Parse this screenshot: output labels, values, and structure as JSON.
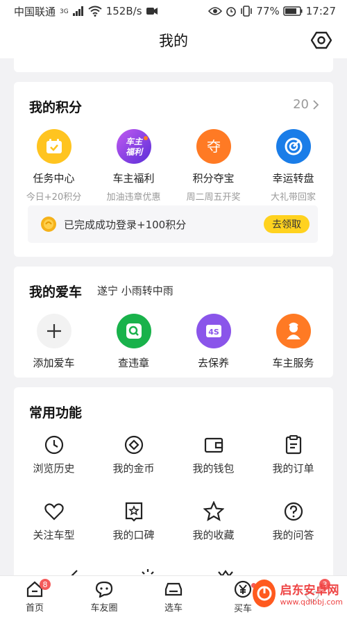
{
  "status_bar": {
    "carrier": "中国联通",
    "network": "3G",
    "speed": "152B/s",
    "battery": "77%",
    "time": "17:27"
  },
  "header": {
    "title": "我的"
  },
  "points": {
    "title": "我的积分",
    "count": "20",
    "items": [
      {
        "label": "任务中心",
        "sub": "今日+20积分",
        "color": "#ffc420"
      },
      {
        "label": "车主福利",
        "sub": "加油违章优惠",
        "color": "#7b3fe0",
        "badge": "车主\n福利"
      },
      {
        "label": "积分夺宝",
        "sub": "周二周五开奖",
        "color": "#ff7a24",
        "glyph": "夺"
      },
      {
        "label": "幸运转盘",
        "sub": "大礼带回家",
        "color": "#1a7de8"
      }
    ],
    "bonus_text": "已完成成功登录+100积分",
    "bonus_button": "去领取"
  },
  "car": {
    "title": "我的爱车",
    "weather": "遂宁  小雨转中雨",
    "items": [
      {
        "label": "添加爱车",
        "color": "#f2f2f2"
      },
      {
        "label": "查违章",
        "color": "#19b24b"
      },
      {
        "label": "去保养",
        "color": "#8a55ea",
        "glyph": "4S"
      },
      {
        "label": "车主服务",
        "color": "#ff7a24"
      }
    ]
  },
  "functions": {
    "title": "常用功能",
    "items": [
      {
        "label": "浏览历史",
        "icon": "clock-icon"
      },
      {
        "label": "我的金币",
        "icon": "coin-icon"
      },
      {
        "label": "我的钱包",
        "icon": "wallet-icon"
      },
      {
        "label": "我的订单",
        "icon": "order-icon"
      },
      {
        "label": "关注车型",
        "icon": "heart-icon"
      },
      {
        "label": "我的口碑",
        "icon": "review-icon"
      },
      {
        "label": "我的收藏",
        "icon": "star-icon"
      },
      {
        "label": "我的问答",
        "icon": "question-icon"
      }
    ]
  },
  "tabbar": {
    "items": [
      {
        "label": "首页",
        "badge": "8"
      },
      {
        "label": "车友圈"
      },
      {
        "label": "选车"
      },
      {
        "label": "买车",
        "dot": true
      },
      {
        "label": "",
        "badge": "3"
      }
    ]
  },
  "watermark": {
    "title": "启东安卓网",
    "url": "www.qdlbbj.com"
  }
}
